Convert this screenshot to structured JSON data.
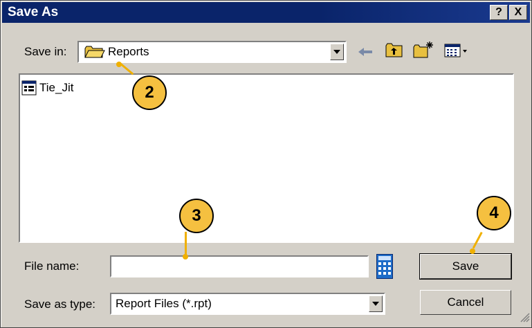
{
  "window": {
    "title": "Save As",
    "help_btn": "?",
    "close_btn": "X"
  },
  "save_in": {
    "label": "Save in:",
    "value": "Reports"
  },
  "toolbar": {
    "icons": [
      "back-arrow-icon",
      "up-folder-icon",
      "new-folder-icon",
      "view-menu-icon"
    ]
  },
  "files": [
    {
      "name": "Tie_Jit",
      "icon": "report-file-icon"
    }
  ],
  "file_name": {
    "label": "File name:",
    "value": ""
  },
  "save_as_type": {
    "label": "Save as type:",
    "value": "Report Files (*.rpt)"
  },
  "buttons": {
    "save": "Save",
    "cancel": "Cancel"
  },
  "callouts": [
    "2",
    "3",
    "4"
  ],
  "colors": {
    "title_bar": "#0a246a",
    "callout": "#f5c040",
    "leader": "#f0b000"
  }
}
